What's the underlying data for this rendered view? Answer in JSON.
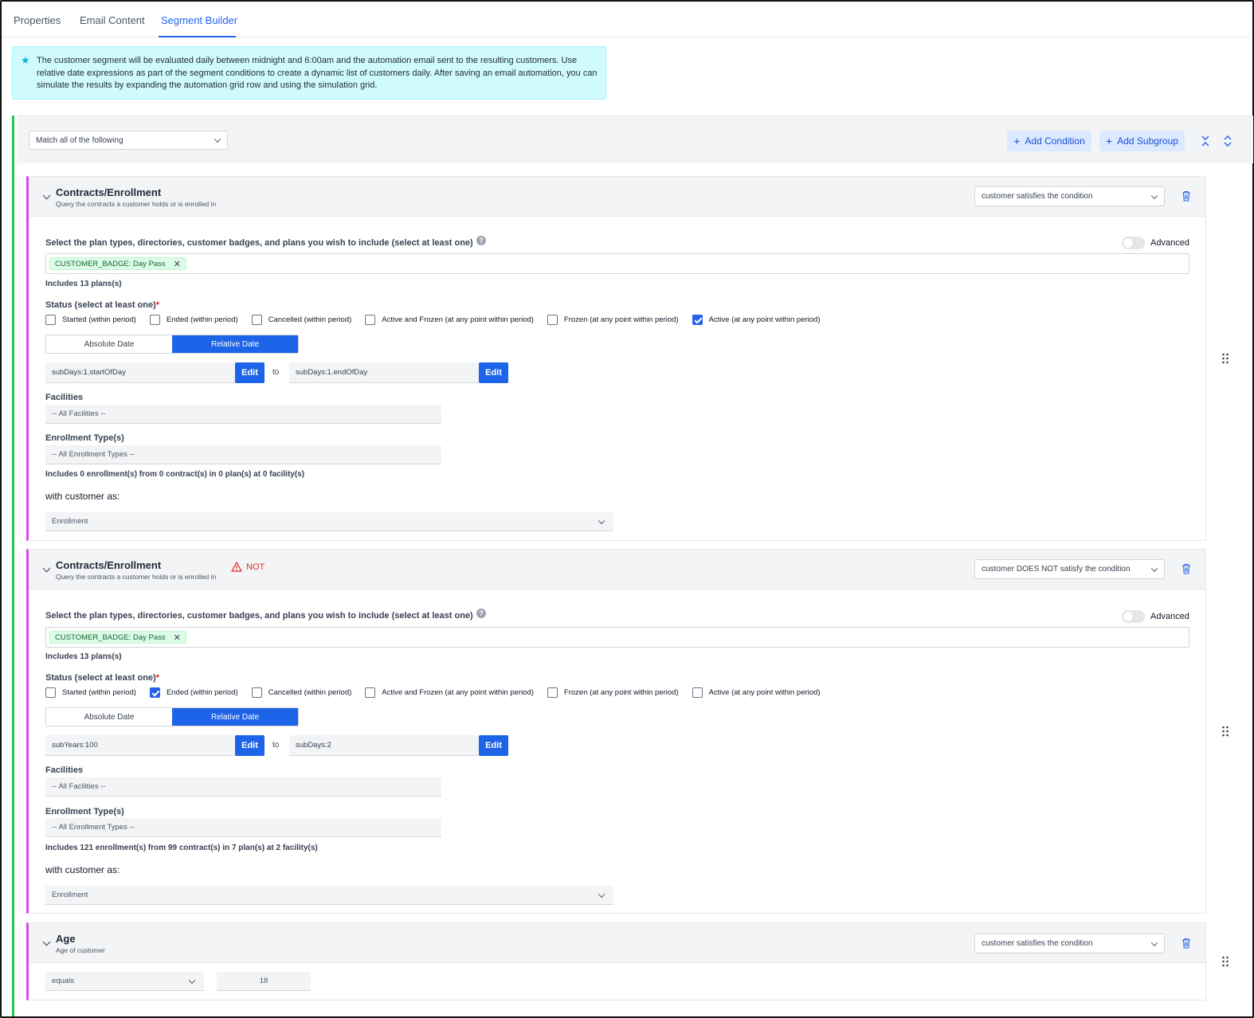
{
  "tabs": [
    {
      "label": "Properties"
    },
    {
      "label": "Email Content"
    },
    {
      "label": "Segment Builder"
    }
  ],
  "banner": {
    "text": "The customer segment will be evaluated daily between midnight and 6:00am and the automation email sent to the resulting customers. Use relative date expressions as part of the segment conditions to create a dynamic list of customers daily. After saving an email automation, you can simulate the results by expanding the automation grid row and using the simulation grid."
  },
  "group": {
    "match_select": "Match all of the following",
    "add_condition": "Add Condition",
    "add_subgroup": "Add Subgroup"
  },
  "common": {
    "plan_label": "Select the plan types, directories, customer badges, and plans you wish to include (select at least one)",
    "advanced_label": "Advanced",
    "status_label": "Status (select at least one)",
    "required_mark": "*",
    "statuses": [
      "Started (within period)",
      "Ended (within period)",
      "Cancelled (within period)",
      "Active and Frozen (at any point within period)",
      "Frozen (at any point within period)",
      "Active (at any point within period)"
    ],
    "absolute_date": "Absolute Date",
    "relative_date": "Relative Date",
    "edit": "Edit",
    "to": "to",
    "facilities_label": "Facilities",
    "facilities_value": "-- All Facilities --",
    "enrollment_types_label": "Enrollment Type(s)",
    "enrollment_types_value": "-- All Enrollment Types --",
    "with_customer_as": "with customer as:"
  },
  "conditions": [
    {
      "title": "Contracts/Enrollment",
      "subtitle": "Query the contracts a customer holds or is enrolled in",
      "mode": "customer satisfies the condition",
      "tag": "CUSTOMER_BADGE: Day Pass",
      "plans_count": "Includes 13 plans(s)",
      "checked": [
        false,
        false,
        false,
        false,
        false,
        true
      ],
      "date_from": "subDays:1.startOfDay",
      "date_to": "subDays:1.endOfDay",
      "summary": "Includes 0 enrollment(s) from 0 contract(s) in 0 plan(s) at 0 facility(s)",
      "customer_as": "Enrollment"
    },
    {
      "title": "Contracts/Enrollment",
      "subtitle": "Query the contracts a customer holds or is enrolled in",
      "not_label": "NOT",
      "mode": "customer DOES NOT satisfy the condition",
      "tag": "CUSTOMER_BADGE: Day Pass",
      "plans_count": "Includes 13 plans(s)",
      "checked": [
        false,
        true,
        false,
        false,
        false,
        false
      ],
      "date_from": "subYears:100",
      "date_to": "subDays:2",
      "summary": "Includes 121 enrollment(s) from 99 contract(s) in 7 plan(s) at 2 facility(s)",
      "customer_as": "Enrollment"
    },
    {
      "title": "Age",
      "subtitle": "Age of customer",
      "mode": "customer satisfies the condition",
      "operator": "equals",
      "value": "18"
    }
  ],
  "icons": {
    "info": "star-icon",
    "warning": "warning-triangle-icon",
    "trash": "trash-icon",
    "drag": "drag-handle-icon",
    "collapse_all": "collapse-all-icon",
    "expand_all": "expand-all-icon"
  },
  "colors": {
    "primary": "#1d64e8",
    "group_border": "#22c55e",
    "card_border": "#d946ef",
    "banner_bg": "#cffafe",
    "danger": "#dc2626",
    "tag_bg": "#dcfce7"
  }
}
